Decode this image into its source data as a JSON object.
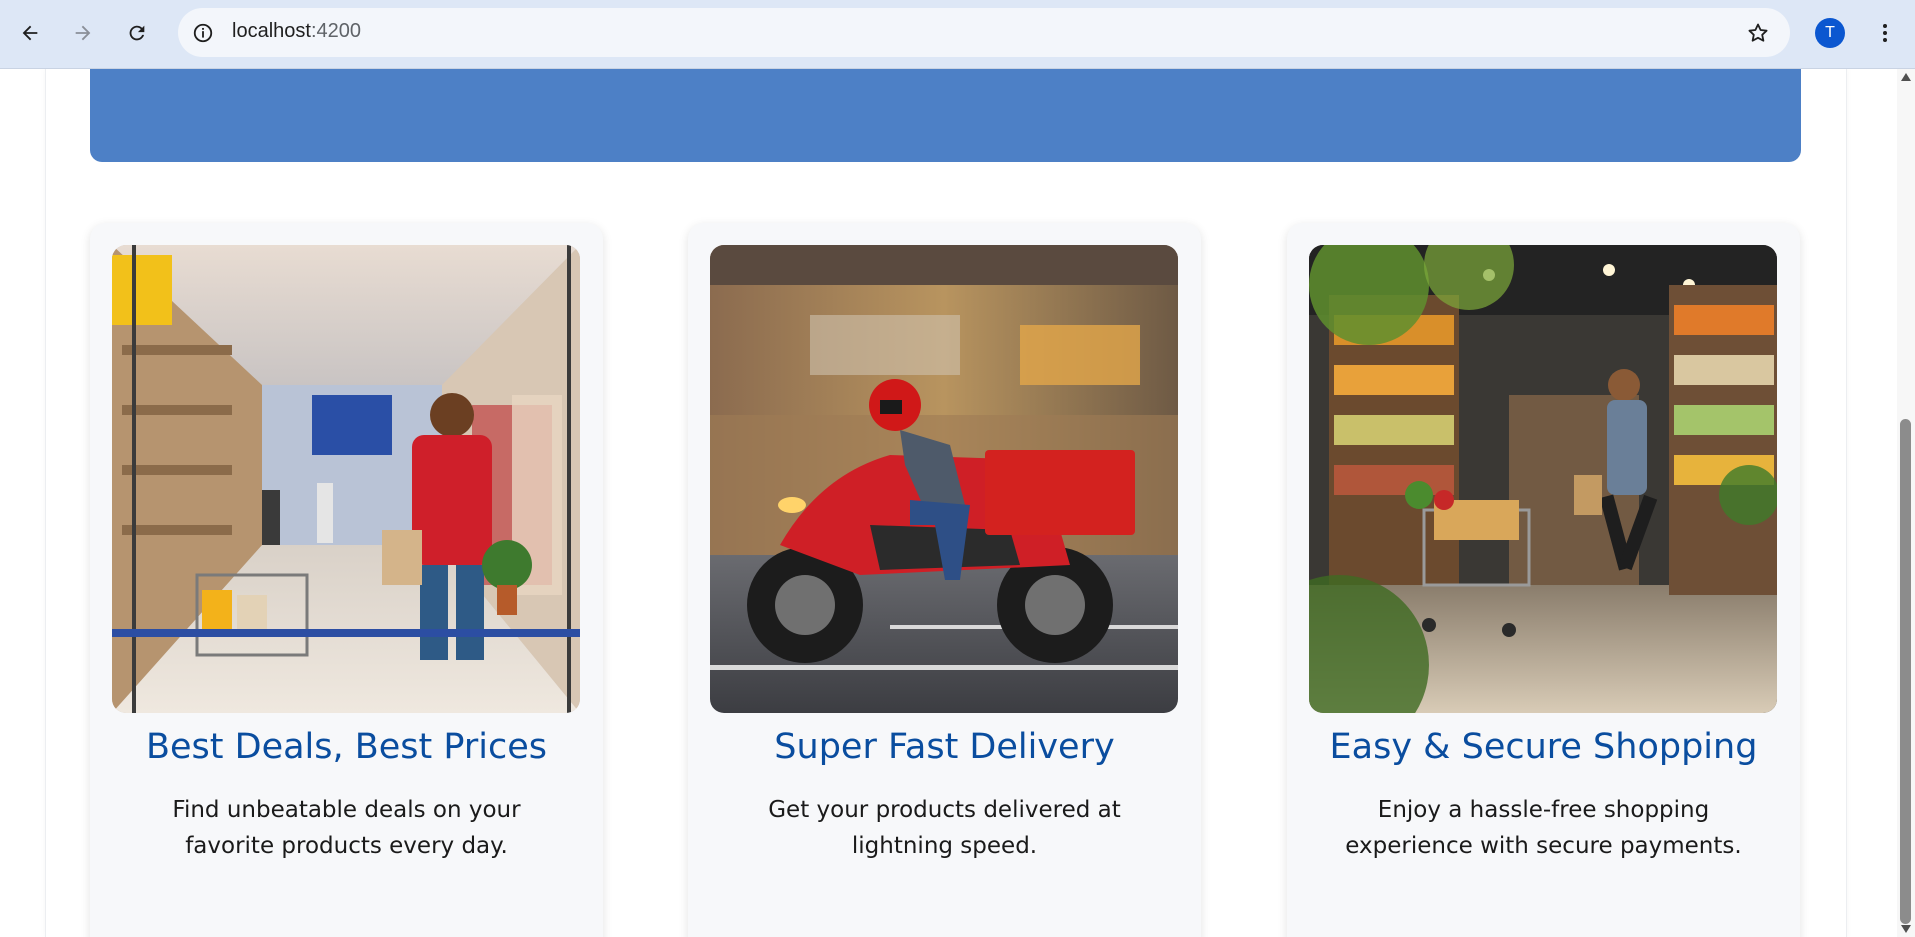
{
  "browser": {
    "url_host": "localhost",
    "url_port": ":4200",
    "profile_initial": "T",
    "icons": [
      "back-arrow-icon",
      "forward-arrow-icon",
      "reload-icon",
      "site-info-icon",
      "bookmark-star-icon",
      "kebab-menu-icon"
    ]
  },
  "colors": {
    "banner": "#4d80c6",
    "title": "#0a4d9f",
    "card_bg": "#f7f8fa"
  },
  "features": [
    {
      "title": "Best Deals, Best Prices",
      "description": "Find unbeatable deals on your favorite products every day.",
      "image": "shopper-in-clothing-store"
    },
    {
      "title": "Super Fast Delivery",
      "description": "Get your products delivered at lightning speed.",
      "image": "delivery-scooter-rider"
    },
    {
      "title": "Easy & Secure Shopping",
      "description": "Enjoy a hassle-free shopping experience with secure payments.",
      "image": "shopper-with-cart-in-supermarket"
    }
  ]
}
